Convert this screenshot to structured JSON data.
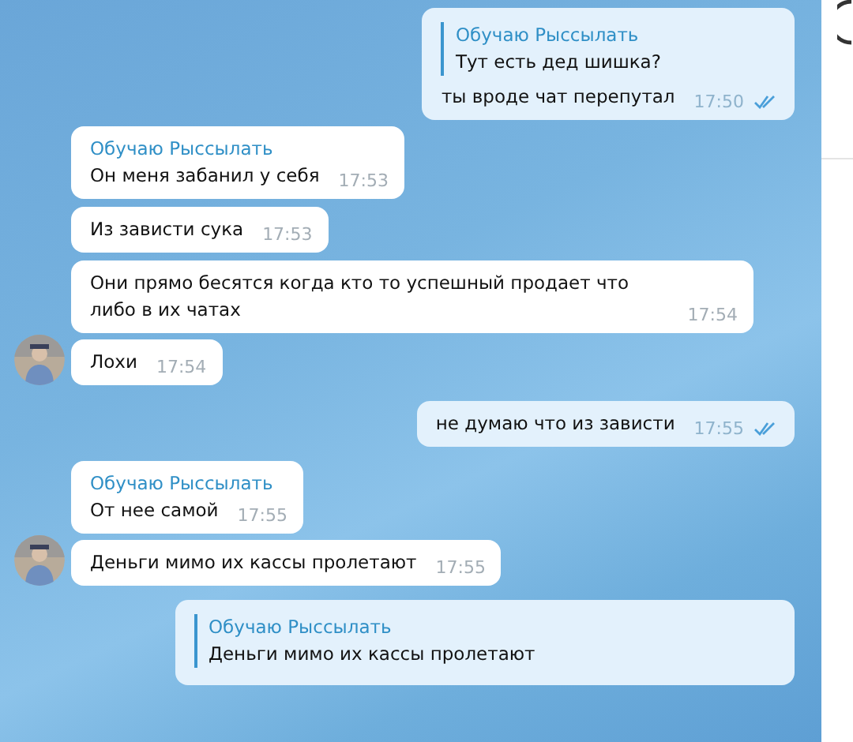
{
  "messages": [
    {
      "kind": "outgoing",
      "reply": {
        "name": "Обучаю Рыссылать",
        "text": "Тут есть дед шишка?"
      },
      "text": "ты вроде чат перепутал",
      "time": "17:50",
      "read": true
    },
    {
      "kind": "incoming",
      "sender": "Обучаю Рыссылать",
      "text": "Он меня забанил у себя",
      "time": "17:53",
      "avatar": false
    },
    {
      "kind": "incoming",
      "text": "Из зависти сука",
      "time": "17:53",
      "avatar": false
    },
    {
      "kind": "incoming",
      "text": "Они прямо бесятся когда кто то успешный продает что либо в их чатах",
      "time": "17:54",
      "avatar": false
    },
    {
      "kind": "incoming",
      "text": "Лохи",
      "time": "17:54",
      "avatar": true
    },
    {
      "kind": "outgoing",
      "text": "не думаю что из зависти",
      "time": "17:55",
      "read": true
    },
    {
      "kind": "incoming",
      "sender": "Обучаю Рыссылать",
      "text": "От нее самой",
      "time": "17:55",
      "avatar": false
    },
    {
      "kind": "incoming",
      "text": "Деньги мимо их кассы пролетают",
      "time": "17:55",
      "avatar": true
    },
    {
      "kind": "outgoing",
      "reply": {
        "name": "Обучаю Рыссылать",
        "text": "Деньги мимо их кассы пролетают"
      }
    }
  ]
}
